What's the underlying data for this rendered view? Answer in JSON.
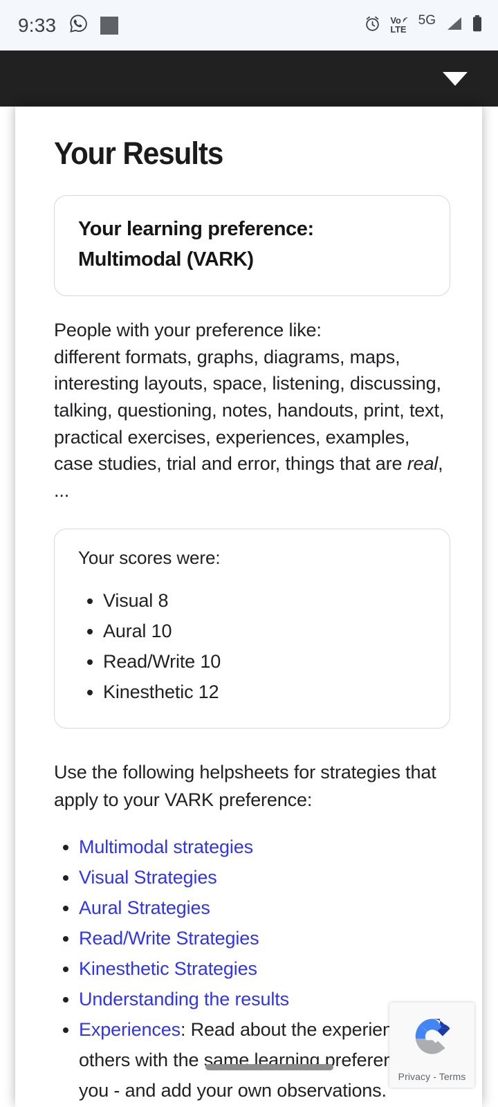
{
  "status_bar": {
    "time": "9:33",
    "icons": [
      "whatsapp-icon",
      "placeholder-square-icon"
    ],
    "right_icons": [
      "alarm-icon",
      "volte-icon",
      "signal-icon",
      "battery-icon"
    ],
    "volte_top": "Vo",
    "volte_bottom": "LTE",
    "network": "5G"
  },
  "app_bar": {
    "caret": "chevron-down-icon"
  },
  "page": {
    "title": "Your Results",
    "preference_box": {
      "label": "Your learning preference:",
      "value": "Multimodal (VARK)"
    },
    "description_intro": "People with your preference like:",
    "description_body_1": "different formats, graphs, diagrams, maps, interesting layouts, space, listening, discussing, talking, questioning, notes, handouts, print, text, practical exercises, experiences, examples, case studies, trial and error, things that are ",
    "description_emphasis": "real",
    "description_body_2": ", ...",
    "scores": {
      "title": "Your scores were:",
      "items": [
        "Visual 8",
        "Aural 10",
        "Read/Write 10",
        "Kinesthetic 12"
      ]
    },
    "helpsheets_intro": "Use the following helpsheets for strategies that apply to your VARK preference:",
    "links": [
      "Multimodal strategies",
      "Visual Strategies",
      "Aural Strategies",
      "Read/Write Strategies",
      "Kinesthetic Strategies",
      "Understanding the results"
    ],
    "experiences_link": "Experiences",
    "experiences_text": ": Read about the experiences of others with the same learning preference as you - and add your own observations."
  },
  "recaptcha": {
    "text": "Privacy - Terms",
    "logo": "recaptcha-icon"
  },
  "chart_data": {
    "type": "bar",
    "title": "Your scores were:",
    "categories": [
      "Visual",
      "Aural",
      "Read/Write",
      "Kinesthetic"
    ],
    "values": [
      8,
      10,
      10,
      12
    ],
    "xlabel": "",
    "ylabel": "",
    "ylim": [
      0,
      12
    ]
  },
  "colors": {
    "link": "#2f33f2",
    "text": "#202124",
    "status_bar_bg": "#f4f7fc",
    "app_bar_bg": "#212121"
  }
}
